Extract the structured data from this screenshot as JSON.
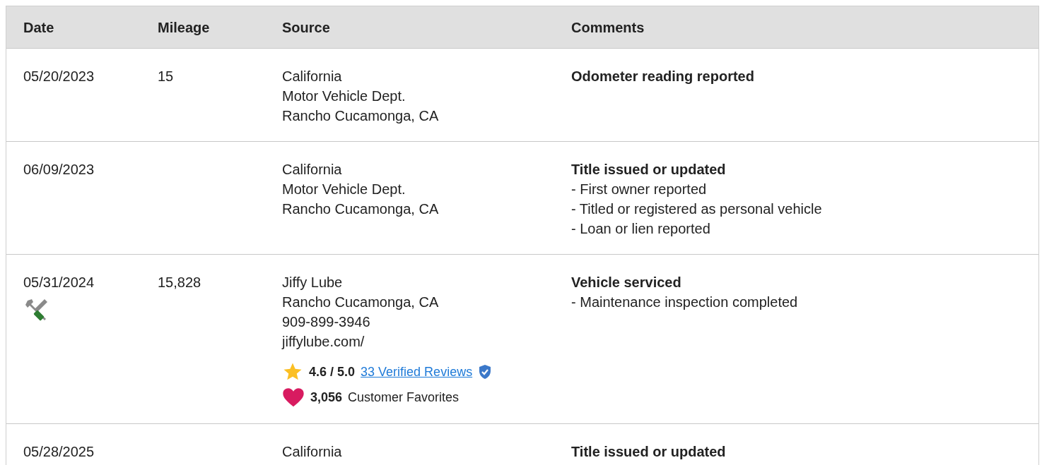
{
  "table": {
    "columns": [
      "Date",
      "Mileage",
      "Source",
      "Comments"
    ],
    "rows": [
      {
        "kind": "record",
        "date": "05/20/2023",
        "mileage": "15",
        "source": [
          "California",
          "Motor Vehicle Dept.",
          "Rancho Cucamonga, CA"
        ],
        "comment_title": "Odometer reading reported",
        "comment_items": []
      },
      {
        "kind": "record",
        "date": "06/09/2023",
        "source": [
          "California",
          "Motor Vehicle Dept.",
          "Rancho Cucamonga, CA"
        ],
        "comment_title": "Title issued or updated",
        "comment_items": [
          "- First owner reported",
          "- Titled or registered as personal vehicle",
          "- Loan or lien reported"
        ]
      },
      {
        "kind": "service",
        "date": "05/31/2024",
        "mileage": "15,828",
        "source": [
          "Jiffy Lube",
          "Rancho Cucamonga, CA",
          "909-899-3946",
          "jiffylube.com/"
        ],
        "rating": {
          "score": "4.6 / 5.0",
          "reviews_link": "33 Verified Reviews",
          "verified": true
        },
        "favorites": {
          "count": "3,056",
          "label": "Customer Favorites"
        },
        "comment_title": "Vehicle serviced",
        "comment_items": [
          "- Maintenance inspection completed"
        ]
      },
      {
        "kind": "record",
        "date": "05/28/2025",
        "source": [
          "California"
        ],
        "comment_title": "Title issued or updated",
        "comment_items": []
      }
    ]
  }
}
